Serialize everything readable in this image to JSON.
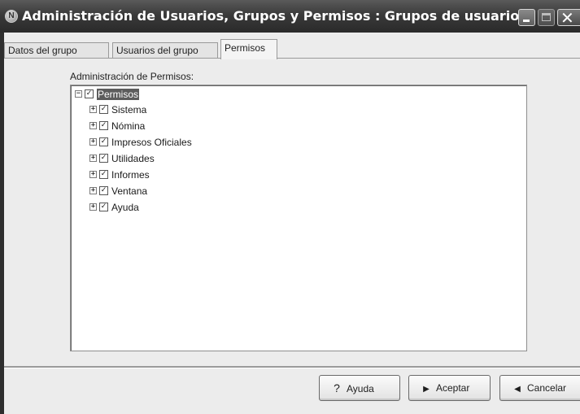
{
  "window": {
    "title": "Administración de Usuarios, Grupos y Permisos : Grupos de usuarios",
    "icon": "app-icon"
  },
  "tabs": [
    {
      "label": "Datos del grupo",
      "active": false
    },
    {
      "label": "Usuarios del grupo",
      "active": false
    },
    {
      "label": "Permisos",
      "active": true
    }
  ],
  "permissions": {
    "label": "Administración de Permisos:",
    "root": {
      "label": "Permisos",
      "expanded": true,
      "checked": true,
      "selected": true
    },
    "children": [
      {
        "label": "Sistema",
        "expanded": false,
        "checked": true
      },
      {
        "label": "Nómina",
        "expanded": false,
        "checked": true
      },
      {
        "label": "Impresos Oficiales",
        "expanded": false,
        "checked": true
      },
      {
        "label": "Utilidades",
        "expanded": false,
        "checked": true
      },
      {
        "label": "Informes",
        "expanded": false,
        "checked": true
      },
      {
        "label": "Ventana",
        "expanded": false,
        "checked": true
      },
      {
        "label": "Ayuda",
        "expanded": false,
        "checked": true
      }
    ]
  },
  "buttons": {
    "help": "Ayuda",
    "accept": "Aceptar",
    "cancel": "Cancelar"
  },
  "glyphs": {
    "collapse": "−",
    "expand": "+",
    "check": "✓"
  }
}
